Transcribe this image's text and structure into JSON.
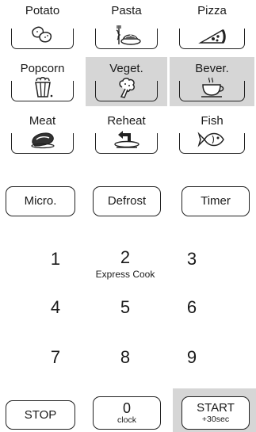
{
  "food_keys": [
    {
      "label": "Potato",
      "icon": "potato-icon"
    },
    {
      "label": "Pasta",
      "icon": "pasta-icon"
    },
    {
      "label": "Pizza",
      "icon": "pizza-icon"
    },
    {
      "label": "Popcorn",
      "icon": "popcorn-icon"
    },
    {
      "label": "Veget.",
      "icon": "vegetable-icon"
    },
    {
      "label": "Bever.",
      "icon": "beverage-icon"
    },
    {
      "label": "Meat",
      "icon": "meat-icon"
    },
    {
      "label": "Reheat",
      "icon": "reheat-icon"
    },
    {
      "label": "Fish",
      "icon": "fish-icon"
    }
  ],
  "mode_keys": {
    "micro": "Micro.",
    "defrost": "Defrost",
    "timer": "Timer"
  },
  "keypad": [
    {
      "digit": "1"
    },
    {
      "digit": "2",
      "sub": "Express Cook"
    },
    {
      "digit": "3"
    },
    {
      "digit": "4"
    },
    {
      "digit": "5"
    },
    {
      "digit": "6"
    },
    {
      "digit": "7"
    },
    {
      "digit": "8"
    },
    {
      "digit": "9"
    }
  ],
  "bottom_keys": {
    "stop": "STOP",
    "zero": "0",
    "zero_sub": "clock",
    "start": "START",
    "start_sub": "+30sec"
  },
  "colors": {
    "highlight": "#d6d6d6",
    "stroke": "#222222"
  }
}
